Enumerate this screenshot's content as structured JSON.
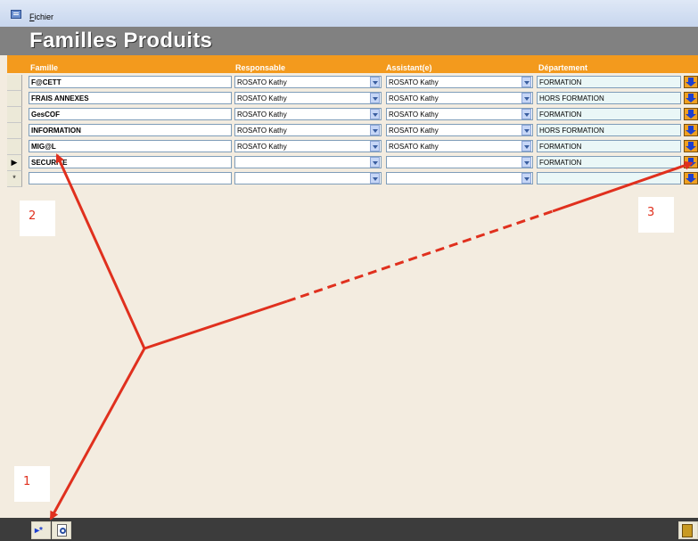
{
  "menubar": {
    "file_prefix": "F",
    "file_rest": "ichier"
  },
  "header": {
    "title": "Familles Produits"
  },
  "columns": {
    "famille": "Famille",
    "responsable": "Responsable",
    "assistant": "Assistant(e)",
    "departement": "Département"
  },
  "rows": [
    {
      "famille": "F@CETT",
      "responsable": "ROSATO Kathy",
      "assistant": "ROSATO Kathy",
      "departement": "FORMATION",
      "selector": ""
    },
    {
      "famille": "FRAIS ANNEXES",
      "responsable": "ROSATO Kathy",
      "assistant": "ROSATO Kathy",
      "departement": "HORS FORMATION",
      "selector": ""
    },
    {
      "famille": "GesCOF",
      "responsable": "ROSATO Kathy",
      "assistant": "ROSATO Kathy",
      "departement": "FORMATION",
      "selector": ""
    },
    {
      "famille": "INFORMATION",
      "responsable": "ROSATO Kathy",
      "assistant": "ROSATO Kathy",
      "departement": "HORS FORMATION",
      "selector": ""
    },
    {
      "famille": "MIG@L",
      "responsable": "ROSATO Kathy",
      "assistant": "ROSATO Kathy",
      "departement": "FORMATION",
      "selector": ""
    },
    {
      "famille": "SECURITE",
      "responsable": "",
      "assistant": "",
      "departement": "FORMATION",
      "selector": "▶"
    },
    {
      "famille": "",
      "responsable": "",
      "assistant": "",
      "departement": "",
      "selector": "*"
    }
  ],
  "annotations": {
    "one": "1",
    "two": "2",
    "three": "3"
  },
  "icons": {
    "go": "blue-down-arrow-icon",
    "new_record": "new-record-icon",
    "preview": "print-preview-icon",
    "exit": "exit-door-icon"
  },
  "colors": {
    "header_bar": "#f39a1d",
    "title_bar": "#818181",
    "annotation": "#e0301e"
  }
}
